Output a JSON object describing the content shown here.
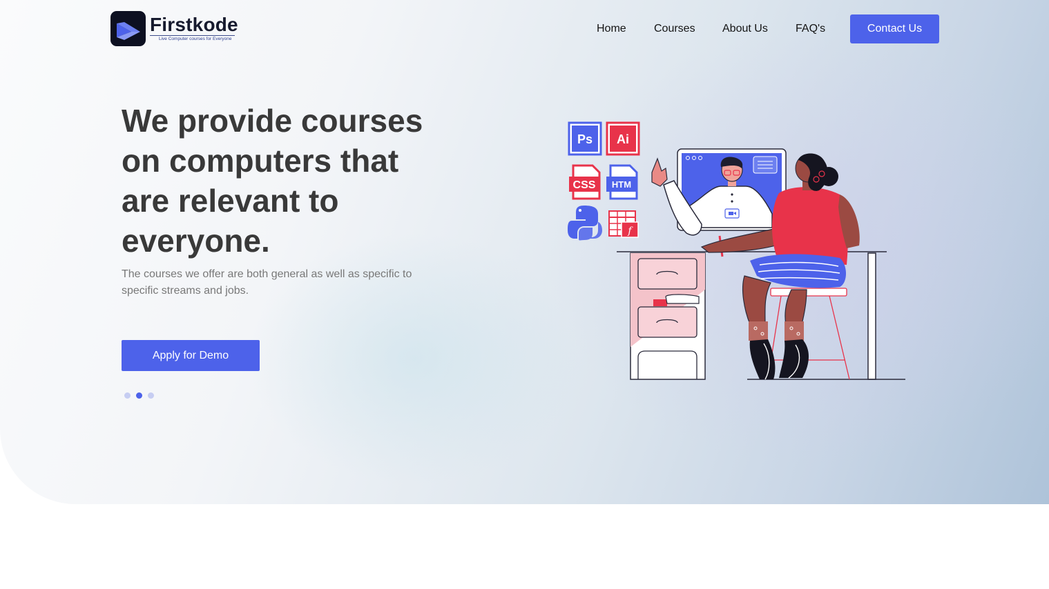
{
  "brand": {
    "name": "Firstkode",
    "tagline": "Live Computer courses for Everyone",
    "icon": "logo-icon"
  },
  "nav": {
    "items": [
      {
        "label": "Home"
      },
      {
        "label": "Courses"
      },
      {
        "label": "About Us"
      },
      {
        "label": "FAQ's"
      }
    ],
    "cta_label": "Contact Us"
  },
  "hero": {
    "headline": "We provide courses on computers that are relevant to everyone.",
    "subtext": "The courses we offer are both general as well as specific to specific streams and jobs.",
    "cta_label": "Apply for Demo",
    "carousel": {
      "total": 3,
      "active": 2
    }
  },
  "illustration": {
    "course_icons": [
      {
        "name": "photoshop-icon",
        "text": "Ps"
      },
      {
        "name": "illustrator-icon",
        "text": "Ai"
      },
      {
        "name": "css-file-icon",
        "text": "CSS"
      },
      {
        "name": "html-file-icon",
        "text": "HTM"
      },
      {
        "name": "python-icon"
      },
      {
        "name": "spreadsheet-formula-icon"
      }
    ]
  },
  "colors": {
    "accent": "#4d62ea",
    "heading": "#393939",
    "body_text": "#787878",
    "illustration_red": "#e8334a",
    "illustration_blue": "#4d62ea",
    "skin": "#9b4a42"
  }
}
